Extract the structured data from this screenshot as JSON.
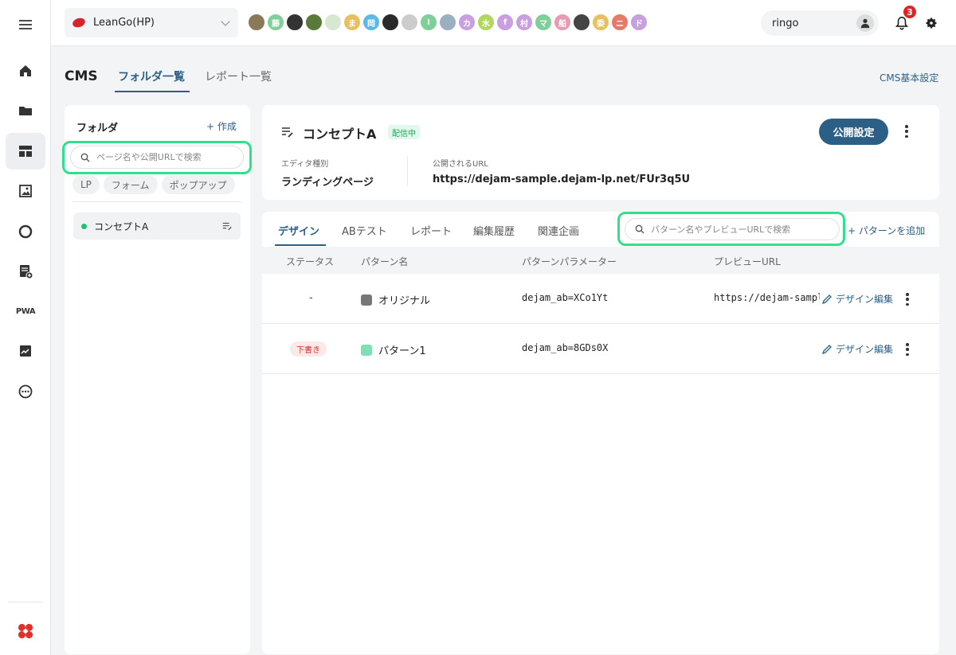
{
  "header": {
    "project_name": "LeanGo(HP)",
    "avatars": [
      {
        "label": "",
        "color": "#8a7a5a"
      },
      {
        "label": "藤",
        "color": "#7fcf9a"
      },
      {
        "label": "",
        "color": "#333333"
      },
      {
        "label": "",
        "color": "#5a7a3a"
      },
      {
        "label": "",
        "color": "#d8e8d0"
      },
      {
        "label": "ま",
        "color": "#e8c060"
      },
      {
        "label": "岡",
        "color": "#5bb8e8"
      },
      {
        "label": "",
        "color": "#2a2a2a"
      },
      {
        "label": "",
        "color": "#cccccc"
      },
      {
        "label": "I",
        "color": "#7fcf9a"
      },
      {
        "label": "",
        "color": "#9ab0c0"
      },
      {
        "label": "カ",
        "color": "#c8a0e0"
      },
      {
        "label": "水",
        "color": "#b0d860"
      },
      {
        "label": "f",
        "color": "#c8a0e0"
      },
      {
        "label": "村",
        "color": "#c8a0e0"
      },
      {
        "label": "マ",
        "color": "#7fcf9a"
      },
      {
        "label": "船",
        "color": "#e89ab0"
      },
      {
        "label": "",
        "color": "#444444"
      },
      {
        "label": "委",
        "color": "#e8c060"
      },
      {
        "label": "ニ",
        "color": "#e87a6a"
      },
      {
        "label": "ド",
        "color": "#c8a0e0"
      }
    ],
    "user_name": "ringo",
    "notification_count": "3"
  },
  "page": {
    "title": "CMS",
    "tabs": [
      "フォルダ一覧",
      "レポート一覧"
    ],
    "settings_link": "CMS基本設定"
  },
  "folder_panel": {
    "title": "フォルダ",
    "create_label": "+ 作成",
    "search_placeholder": "ページ名や公開URLで検索",
    "filters": [
      "LP",
      "フォーム",
      "ポップアップ"
    ],
    "items": [
      {
        "label": "コンセプトA"
      }
    ]
  },
  "page_info": {
    "title": "コンセプトA",
    "status": "配信中",
    "publish_button": "公開設定",
    "editor_type_label": "エディタ種別",
    "editor_type_value": "ランディングページ",
    "public_url_label": "公開されるURL",
    "public_url_value": "https://dejam-sample.dejam-lp.net/FUr3q5U"
  },
  "pattern_panel": {
    "tabs": [
      "デザイン",
      "ABテスト",
      "レポート",
      "編集履歴",
      "関連企画"
    ],
    "search_placeholder": "パターン名やプレビューURLで検索",
    "add_label": "+ パターンを追加",
    "columns": [
      "ステータス",
      "パターン名",
      "パターンパラメーター",
      "プレビューURL"
    ],
    "rows": [
      {
        "status": "-",
        "name": "オリジナル",
        "color": "#777777",
        "param": "dejam_ab=XCo1Yt",
        "preview_url": "https://dejam-sample.dejam-lp.net",
        "edit_label": "デザイン編集"
      },
      {
        "status": "下書き",
        "name": "パターン1",
        "color": "#7fe0b5",
        "param": "dejam_ab=8GDs0X",
        "preview_url": "",
        "edit_label": "デザイン編集"
      }
    ]
  }
}
